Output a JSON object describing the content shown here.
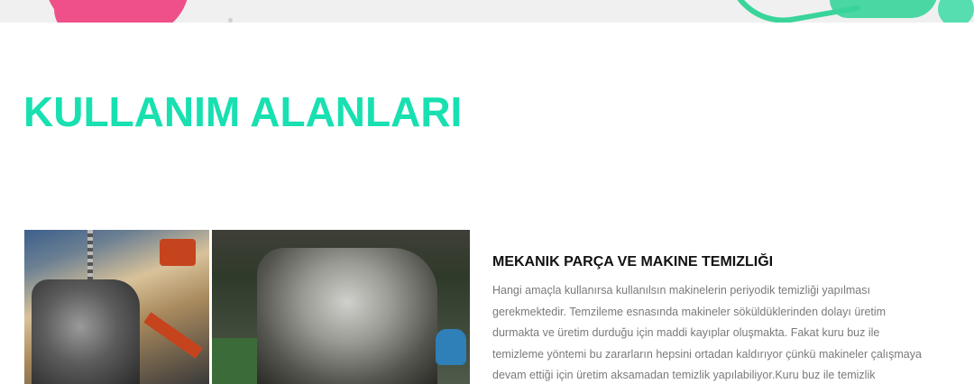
{
  "section": {
    "title": "KULLANIM ALANLARI"
  },
  "article": {
    "heading": "MEKANIK PARÇA VE MAKINE TEMIZLIĞI",
    "lines": [
      "Hangi amaçla kullanırsa kullanılsın makinelerin periyodik temizliği yapılması",
      "gerekmektedir. Temzileme esnasında makineler söküldüklerinden dolayı üretim",
      "durmakta ve üretim durduğu için maddi kayıplar oluşmakta. Fakat kuru buz ile",
      "temizleme yöntemi bu zararların hepsini ortadan kaldırıyor çünkü makineler çalışmaya",
      "devam ettiği için üretim aksamadan temizlik yapılabiliyor.Kuru buz ile temizlik"
    ]
  },
  "colors": {
    "title_accent": "#18e0b0",
    "paint_pink": "#f0508a",
    "paint_green": "#39d49a"
  }
}
